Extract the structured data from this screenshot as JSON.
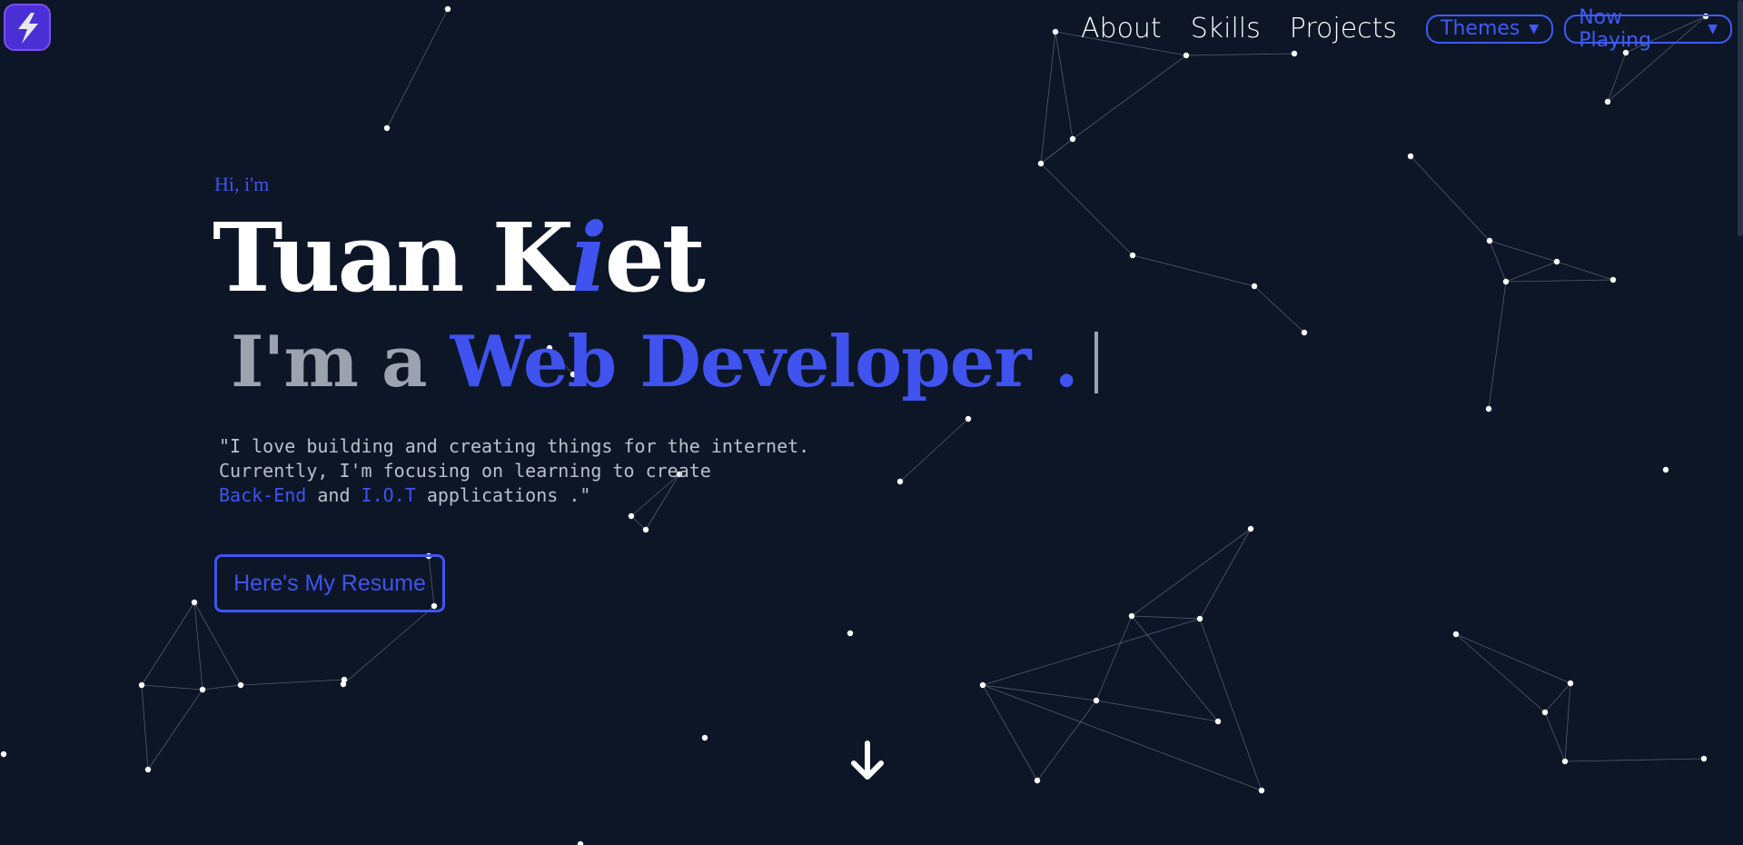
{
  "logo": {
    "icon": "lightning-bolt-logo-icon",
    "bg_color": "#4a2fd6"
  },
  "nav": {
    "links": [
      "About",
      "Skills",
      "Projects"
    ],
    "themes_label": "Themes",
    "now_playing_label": "Now Playing"
  },
  "hero": {
    "greeting": "Hi, i'm",
    "name_part1": "Tuan K",
    "name_accent": "i",
    "name_part2": "et",
    "role_prefix": "I'm a",
    "role_title": "Web Developer .",
    "bio_line1": "\"I love building and creating things for the internet.",
    "bio_line2": "Currently, I'm focusing on learning to create",
    "bio_hl1": "Back-End",
    "bio_and": "and",
    "bio_hl2": "I.O.T",
    "bio_end": "applications .\"",
    "resume_button": "Here's My Resume"
  },
  "colors": {
    "accent": "#4053ee",
    "background": "#0c1627",
    "muted": "#9ca3af"
  },
  "icons": {
    "scroll": "arrow-down-icon",
    "dropdown": "caret-down-icon"
  }
}
